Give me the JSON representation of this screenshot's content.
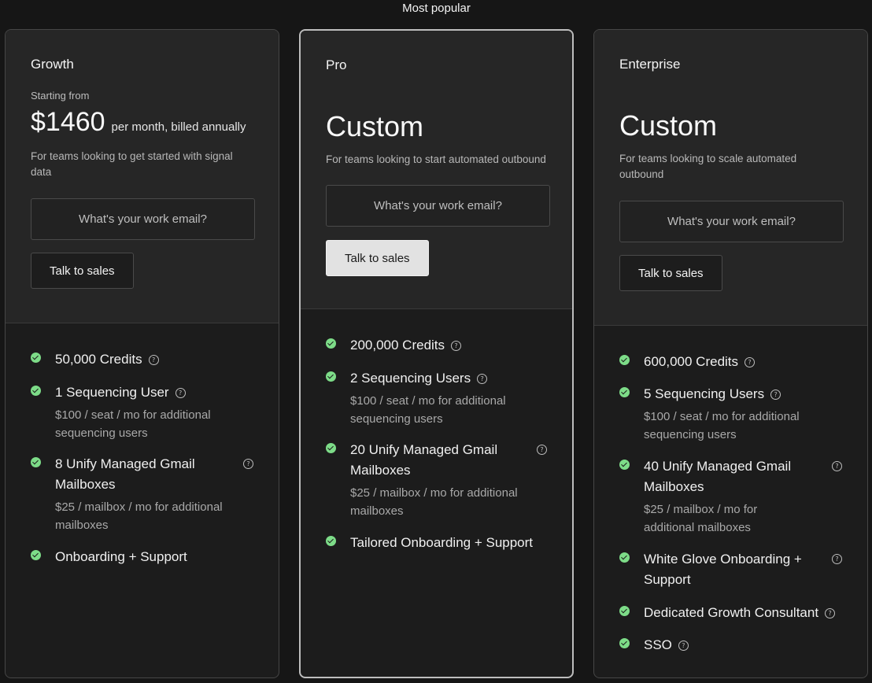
{
  "popular_label": "Most popular",
  "email_placeholder": "What's your work email?",
  "plans": {
    "growth": {
      "name": "Growth",
      "starting_label": "Starting from",
      "price": "$1460",
      "price_note": "per month, billed annually",
      "description": "For teams looking to get started with signal data",
      "cta": "Talk to sales",
      "features": [
        {
          "title": "50,000 Credits",
          "sub": ""
        },
        {
          "title": "1 Sequencing User",
          "sub": "$100 / seat / mo for additional sequencing users"
        },
        {
          "title": "8 Unify Managed Gmail Mailboxes",
          "sub": "$25 / mailbox / mo for additional mailboxes"
        },
        {
          "title": "Onboarding + Support",
          "sub": ""
        }
      ]
    },
    "pro": {
      "name": "Pro",
      "price": "Custom",
      "description": "For teams looking to start automated outbound",
      "cta": "Talk to sales",
      "features": [
        {
          "title": "200,000 Credits",
          "sub": ""
        },
        {
          "title": "2 Sequencing Users",
          "sub": "$100 / seat / mo for additional sequencing users"
        },
        {
          "title": "20 Unify Managed Gmail Mailboxes",
          "sub": "$25 / mailbox / mo for additional mailboxes"
        },
        {
          "title": "Tailored Onboarding + Support",
          "sub": ""
        }
      ]
    },
    "enterprise": {
      "name": "Enterprise",
      "price": "Custom",
      "description": "For teams looking to scale automated outbound",
      "cta": "Talk to sales",
      "features": [
        {
          "title": "600,000 Credits",
          "sub": ""
        },
        {
          "title": "5 Sequencing Users",
          "sub": "$100 / seat / mo for additional sequencing users"
        },
        {
          "title": "40 Unify Managed Gmail Mailboxes",
          "sub": "$25 / mailbox / mo for additional mailboxes"
        },
        {
          "title": "White Glove Onboarding + Support",
          "sub": ""
        },
        {
          "title": "Dedicated Growth Consultant",
          "sub": ""
        },
        {
          "title": "SSO",
          "sub": ""
        }
      ]
    }
  },
  "icon_names": {
    "check": "check-circle-icon",
    "help": "question-circle-icon"
  },
  "colors": {
    "accent_check": "#7ddc88",
    "background": "#161616",
    "card": "#1c1c1c"
  }
}
